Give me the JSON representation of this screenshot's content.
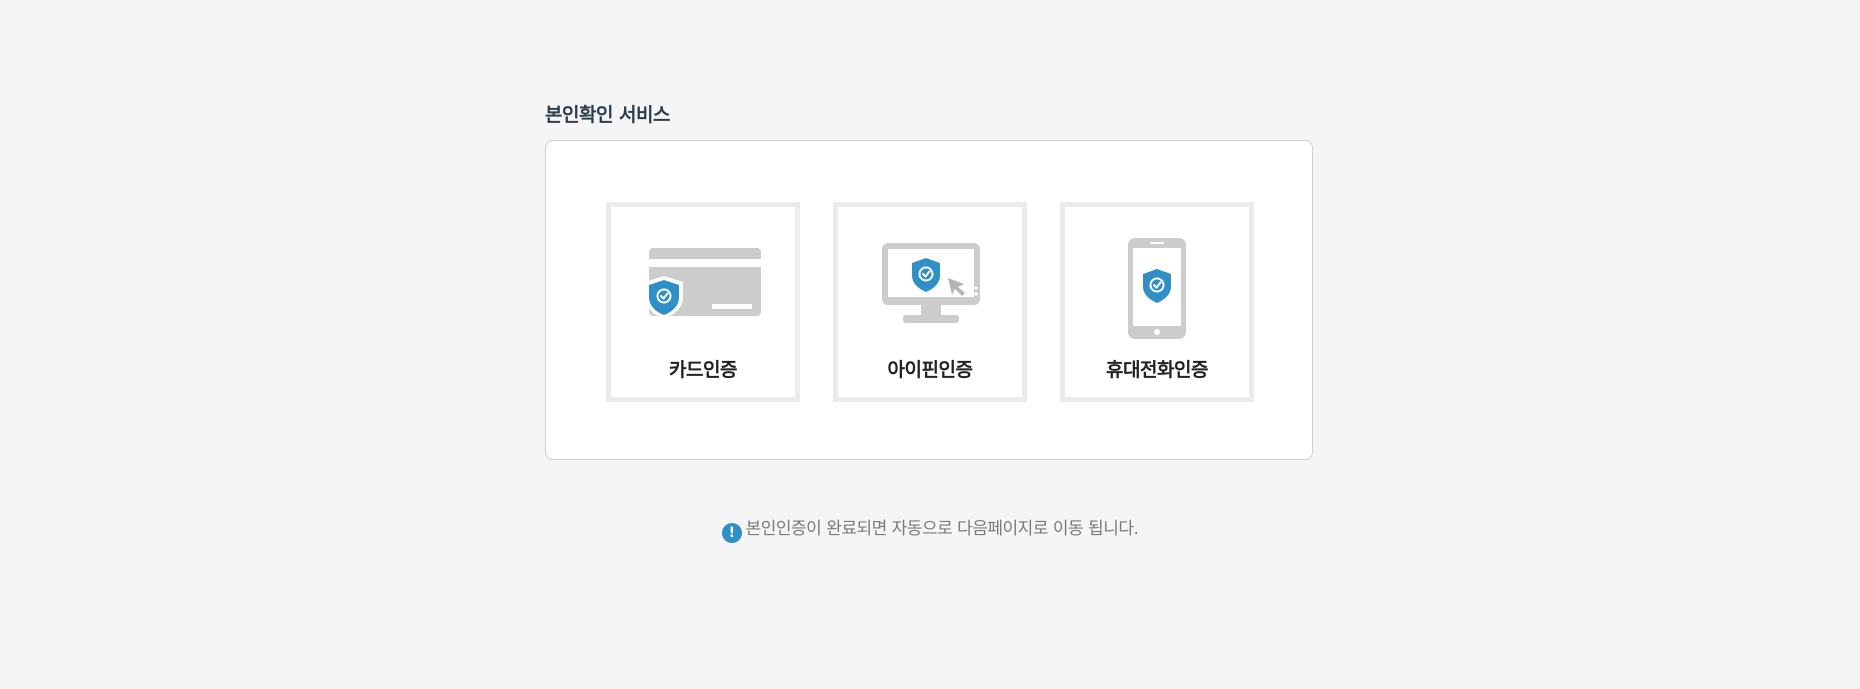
{
  "page": {
    "title": "본인확인 서비스"
  },
  "auth_options": [
    {
      "label": "카드인증",
      "icon": "credit-card-shield-icon"
    },
    {
      "label": "아이핀인증",
      "icon": "monitor-shield-icon"
    },
    {
      "label": "휴대전화인증",
      "icon": "mobile-phone-shield-icon"
    }
  ],
  "notice": {
    "icon": "exclamation-icon",
    "icon_glyph": "!",
    "text": "본인인증이 완료되면 자동으로 다음페이지로 이동 됩니다."
  },
  "colors": {
    "background": "#f5f5f5",
    "accent_blue": "#2f8fc6",
    "icon_gray": "#cccccc",
    "title": "#2c3e50"
  }
}
